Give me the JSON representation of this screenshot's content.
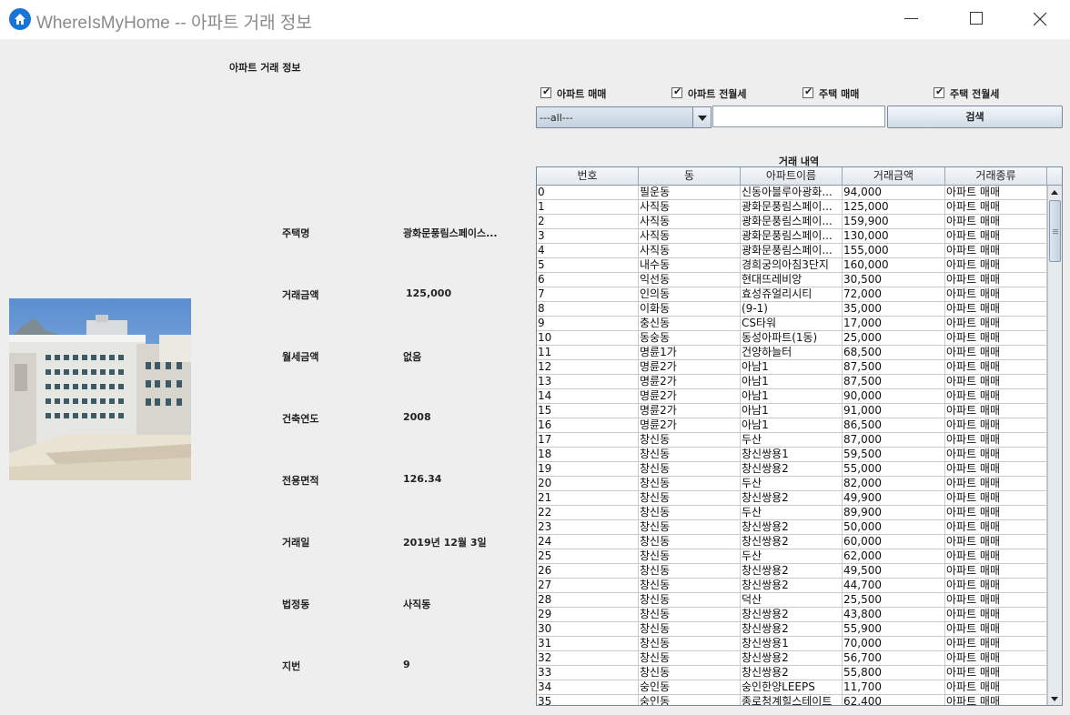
{
  "window": {
    "title": "WhereIsMyHome -- 아파트 거래 정보"
  },
  "left_panel": {
    "section_title": "아파트 거래 정보",
    "details": [
      {
        "label": "주택명",
        "value": "광화문풍림스페이스..."
      },
      {
        "label": "거래금액",
        "value": "125,000"
      },
      {
        "label": "월세금액",
        "value": "없음"
      },
      {
        "label": "건축연도",
        "value": "2008"
      },
      {
        "label": "전용면적",
        "value": "126.34"
      },
      {
        "label": "거래일",
        "value": "2019년 12월 3일"
      },
      {
        "label": "법정동",
        "value": "사직동"
      },
      {
        "label": "지번",
        "value": "9"
      }
    ]
  },
  "filters": {
    "checkboxes": [
      {
        "label": "아파트 매매",
        "checked": true
      },
      {
        "label": "아파트 전월세",
        "checked": true
      },
      {
        "label": "주택 매매",
        "checked": true
      },
      {
        "label": "주택 전월세",
        "checked": true
      }
    ],
    "search_type": "---all---",
    "search_value": "",
    "search_button": "검색"
  },
  "table": {
    "caption": "거래 내역",
    "columns": [
      "번호",
      "동",
      "아파트이름",
      "거래금액",
      "거래종류"
    ],
    "rows": [
      [
        "0",
        "필운동",
        "신동아블루아광화...",
        "94,000",
        "아파트 매매"
      ],
      [
        "1",
        "사직동",
        "광화문풍림스페이...",
        "125,000",
        "아파트 매매"
      ],
      [
        "2",
        "사직동",
        "광화문풍림스페이...",
        "159,900",
        "아파트 매매"
      ],
      [
        "3",
        "사직동",
        "광화문풍림스페이...",
        "130,000",
        "아파트 매매"
      ],
      [
        "4",
        "사직동",
        "광화문풍림스페이...",
        "155,000",
        "아파트 매매"
      ],
      [
        "5",
        "내수동",
        "경희궁의아침3단지",
        "160,000",
        "아파트 매매"
      ],
      [
        "6",
        "익선동",
        "현대뜨레비앙",
        "30,500",
        "아파트 매매"
      ],
      [
        "7",
        "인의동",
        "효성쥬얼리시티",
        "72,000",
        "아파트 매매"
      ],
      [
        "8",
        "이화동",
        "(9-1)",
        "35,000",
        "아파트 매매"
      ],
      [
        "9",
        "충신동",
        "CS타워",
        "17,000",
        "아파트 매매"
      ],
      [
        "10",
        "동숭동",
        "동성아파트(1동)",
        "25,000",
        "아파트 매매"
      ],
      [
        "11",
        "명륜1가",
        "건양하늘터",
        "68,500",
        "아파트 매매"
      ],
      [
        "12",
        "명륜2가",
        "아남1",
        "87,500",
        "아파트 매매"
      ],
      [
        "13",
        "명륜2가",
        "아남1",
        "87,500",
        "아파트 매매"
      ],
      [
        "14",
        "명륜2가",
        "아남1",
        "90,000",
        "아파트 매매"
      ],
      [
        "15",
        "명륜2가",
        "아남1",
        "91,000",
        "아파트 매매"
      ],
      [
        "16",
        "명륜2가",
        "아남1",
        "86,500",
        "아파트 매매"
      ],
      [
        "17",
        "창신동",
        "두산",
        "87,000",
        "아파트 매매"
      ],
      [
        "18",
        "창신동",
        "창신쌍용1",
        "59,500",
        "아파트 매매"
      ],
      [
        "19",
        "창신동",
        "창신쌍용2",
        "55,000",
        "아파트 매매"
      ],
      [
        "20",
        "창신동",
        "두산",
        "82,000",
        "아파트 매매"
      ],
      [
        "21",
        "창신동",
        "창신쌍용2",
        "49,900",
        "아파트 매매"
      ],
      [
        "22",
        "창신동",
        "두산",
        "89,900",
        "아파트 매매"
      ],
      [
        "23",
        "창신동",
        "창신쌍용2",
        "50,000",
        "아파트 매매"
      ],
      [
        "24",
        "창신동",
        "창신쌍용2",
        "60,000",
        "아파트 매매"
      ],
      [
        "25",
        "창신동",
        "두산",
        "62,000",
        "아파트 매매"
      ],
      [
        "26",
        "창신동",
        "창신쌍용2",
        "49,500",
        "아파트 매매"
      ],
      [
        "27",
        "창신동",
        "창신쌍용2",
        "44,700",
        "아파트 매매"
      ],
      [
        "28",
        "창신동",
        "덕산",
        "25,500",
        "아파트 매매"
      ],
      [
        "29",
        "창신동",
        "창신쌍용2",
        "43,800",
        "아파트 매매"
      ],
      [
        "30",
        "창신동",
        "창신쌍용2",
        "55,900",
        "아파트 매매"
      ],
      [
        "31",
        "창신동",
        "창신쌍용1",
        "70,000",
        "아파트 매매"
      ],
      [
        "32",
        "창신동",
        "창신쌍용2",
        "56,700",
        "아파트 매매"
      ],
      [
        "33",
        "창신동",
        "창신쌍용2",
        "55,800",
        "아파트 매매"
      ],
      [
        "34",
        "숭인동",
        "숭인한양LEEPS",
        "11,700",
        "아파트 매매"
      ],
      [
        "35",
        "숭인동",
        "종로청계힐스테이트",
        "62,400",
        "아파트 매매"
      ]
    ]
  },
  "icons": {
    "app": "home-icon",
    "minimize": "minimize-icon",
    "maximize": "maximize-icon",
    "close": "close-icon"
  },
  "colors": {
    "app_icon": "#1a73d9",
    "window_bg": "#eeeeee"
  }
}
